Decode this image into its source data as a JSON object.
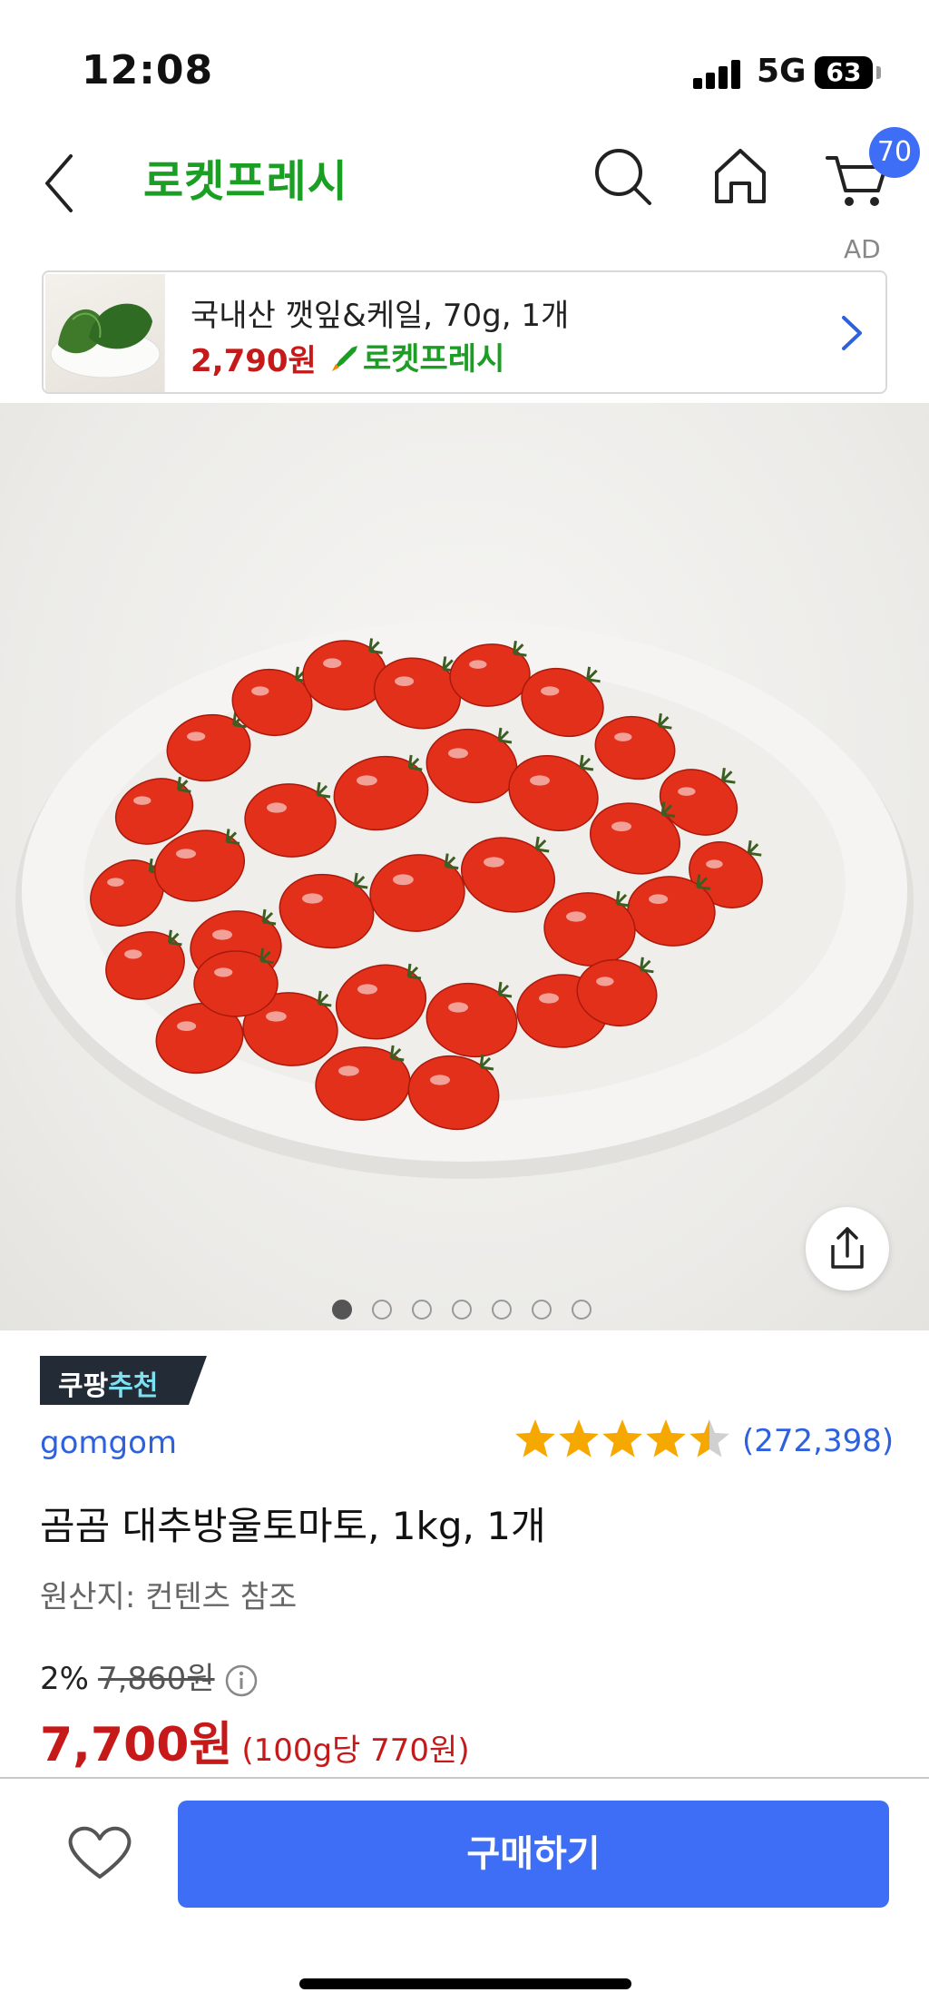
{
  "status_bar": {
    "time": "12:08",
    "network": "5G",
    "battery": "63"
  },
  "header": {
    "title": "로켓프레시",
    "cart_count": "70",
    "icons": [
      "back-icon",
      "search-icon",
      "home-icon",
      "cart-icon"
    ]
  },
  "ad": {
    "label": "AD",
    "product_name": "국내산 깻잎&케일, 70g, 1개",
    "price": "2,790원",
    "delivery": "로켓프레시"
  },
  "gallery": {
    "image_count": 7,
    "active_index": 0
  },
  "product": {
    "badge_prefix": "쿠팡",
    "badge_highlight": "추천",
    "brand": "gomgom",
    "rating": 4.5,
    "review_count": "(272,398)",
    "title": "곰곰 대추방울토마토, 1kg, 1개",
    "origin": "원산지: 컨텐츠 참조",
    "discount": "2%",
    "original_price": "7,860원",
    "price": "7,700원",
    "unit_price": "(100g당 770원)"
  },
  "bottom": {
    "buy_label": "구매하기"
  },
  "colors": {
    "accent_blue": "#3d6ef5",
    "price_red": "#c61a1a",
    "rocket_green": "#1a9e23",
    "star": "#f6a800"
  }
}
